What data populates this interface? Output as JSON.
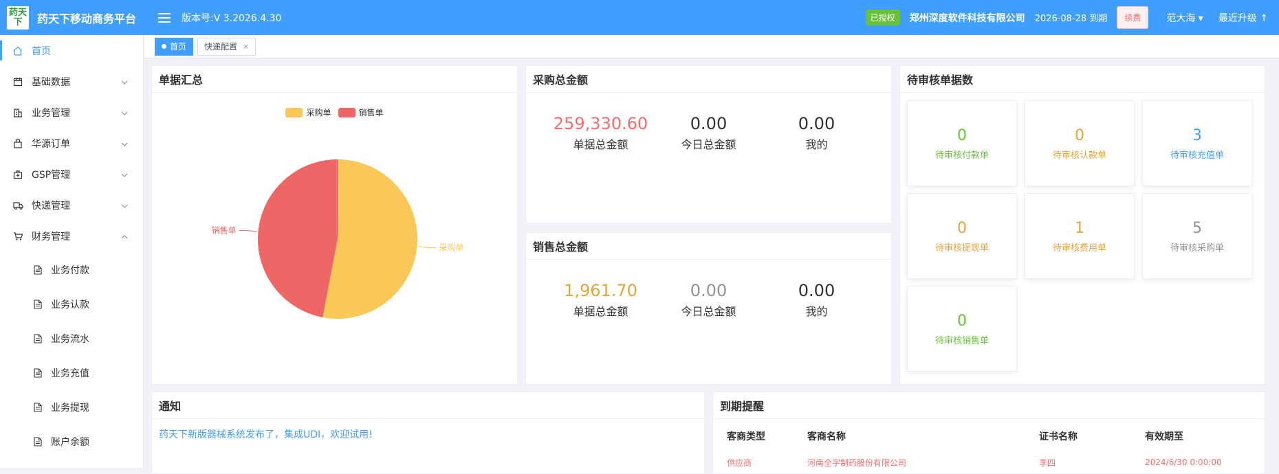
{
  "header": {
    "logo_text": "药天下",
    "app_title": "药天下移动商务平台",
    "version": "版本号:V 3.2026.4.30",
    "auth_badge": "已授权",
    "company": "郑州深度软件科技有限公司",
    "expire": "2026-08-28 到期",
    "renew": "续费",
    "user": "范大海",
    "upgrade": "最近升级"
  },
  "sidebar": {
    "items": [
      {
        "label": "首页"
      },
      {
        "label": "基础数据"
      },
      {
        "label": "业务管理"
      },
      {
        "label": "华源订单"
      },
      {
        "label": "GSP管理"
      },
      {
        "label": "快递管理"
      },
      {
        "label": "财务管理"
      }
    ],
    "sub_items": [
      {
        "label": "业务付款"
      },
      {
        "label": "业务认款"
      },
      {
        "label": "业务流水"
      },
      {
        "label": "业务充值"
      },
      {
        "label": "业务提现"
      },
      {
        "label": "账户余额"
      }
    ]
  },
  "tags": [
    {
      "label": "首页"
    },
    {
      "label": "快递配置"
    }
  ],
  "summary": {
    "title": "单据汇总",
    "legend": [
      "采购单",
      "销售单"
    ],
    "label_purchase": "采购单",
    "label_sales": "销售单"
  },
  "chart_data": {
    "type": "pie",
    "title": "单据汇总",
    "categories": [
      "采购单",
      "销售单"
    ],
    "values": [
      53,
      47
    ],
    "colors": [
      "#fac858",
      "#ee6666"
    ]
  },
  "purchase": {
    "title": "采购总金额",
    "stats": [
      {
        "value": "259,330.60",
        "label": "单据总金额",
        "color": "#f56c6c"
      },
      {
        "value": "0.00",
        "label": "今日总金额",
        "color": "#303133"
      },
      {
        "value": "0.00",
        "label": "我的",
        "color": "#303133"
      }
    ]
  },
  "sales": {
    "title": "销售总金额",
    "stats": [
      {
        "value": "1,961.70",
        "label": "单据总金额",
        "color": "#e6a23c"
      },
      {
        "value": "0.00",
        "label": "今日总金额",
        "color": "#909399"
      },
      {
        "value": "0.00",
        "label": "我的",
        "color": "#303133"
      }
    ]
  },
  "pending": {
    "title": "待审核单据数",
    "items": [
      {
        "count": "0",
        "label": "待审核付款单",
        "color": "#67c23a"
      },
      {
        "count": "0",
        "label": "待审核认款单",
        "color": "#e6a23c"
      },
      {
        "count": "3",
        "label": "待审核充值单",
        "color": "#409eff"
      },
      {
        "count": "0",
        "label": "待审核提现单",
        "color": "#e6a23c"
      },
      {
        "count": "1",
        "label": "待审核费用单",
        "color": "#e6a23c"
      },
      {
        "count": "5",
        "label": "待审核采购单",
        "color": "#909399"
      },
      {
        "count": "0",
        "label": "待审核销售单",
        "color": "#67c23a"
      }
    ]
  },
  "notice": {
    "title": "通知",
    "text": "药天下新版器械系统发布了，集成UDI，欢迎试用!"
  },
  "reminder": {
    "title": "到期提醒",
    "columns": [
      "客商类型",
      "客商名称",
      "证书名称",
      "有效期至"
    ],
    "rows": [
      [
        "供应商",
        "河南全宇制药股份有限公司",
        "李四",
        "2024/6/30 0:00:00"
      ]
    ]
  }
}
